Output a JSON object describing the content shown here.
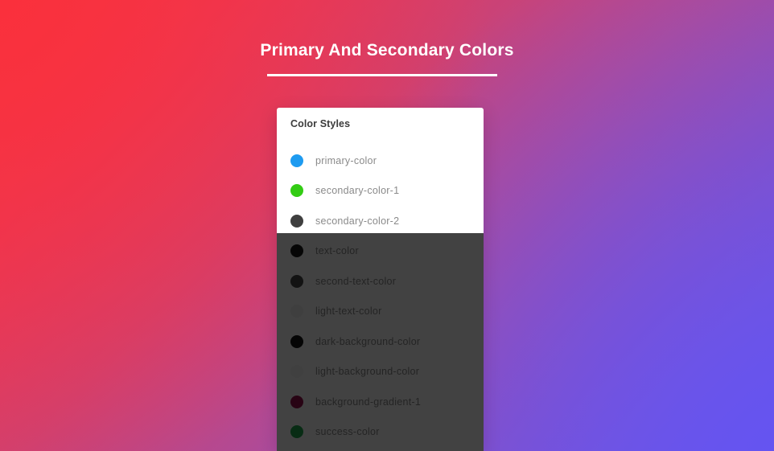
{
  "page": {
    "title": "Primary And Secondary Colors",
    "background_gradient_from": "#f73641",
    "background_gradient_mid": "#cf4171",
    "background_gradient_to": "#6a58e8",
    "title_color": "#ffffff"
  },
  "card": {
    "heading": "Color Styles",
    "background": "#ffffff",
    "overlay_color": "rgba(0,0,0,0.74)",
    "items": [
      {
        "label": "primary-color",
        "swatch": "#1e9bf0",
        "swatch_name": "color-swatch-primary-color"
      },
      {
        "label": "secondary-color-1",
        "swatch": "#33cc14",
        "swatch_name": "color-swatch-secondary-color-1"
      },
      {
        "label": "secondary-color-2",
        "swatch": "#3f3f3f",
        "swatch_name": "color-swatch-secondary-color-2"
      },
      {
        "label": "text-color",
        "swatch": "#1a1a1a",
        "swatch_name": "color-swatch-text-color"
      },
      {
        "label": "second-text-color",
        "swatch": "#4a4a4a",
        "swatch_name": "color-swatch-second-text-color"
      },
      {
        "label": "light-text-color",
        "swatch": "#f2f2f2",
        "swatch_name": "color-swatch-light-text-color"
      },
      {
        "label": "dark-background-color",
        "swatch": "#141414",
        "swatch_name": "color-swatch-dark-background-color"
      },
      {
        "label": "light-background-color",
        "swatch": "#f7f7f7",
        "swatch_name": "color-swatch-light-background-color"
      },
      {
        "label": "background-gradient-1",
        "swatch": "#9b1350",
        "swatch_name": "color-swatch-background-gradient-1"
      },
      {
        "label": "success-color",
        "swatch": "#1faa4e",
        "swatch_name": "color-swatch-success-color"
      }
    ]
  }
}
